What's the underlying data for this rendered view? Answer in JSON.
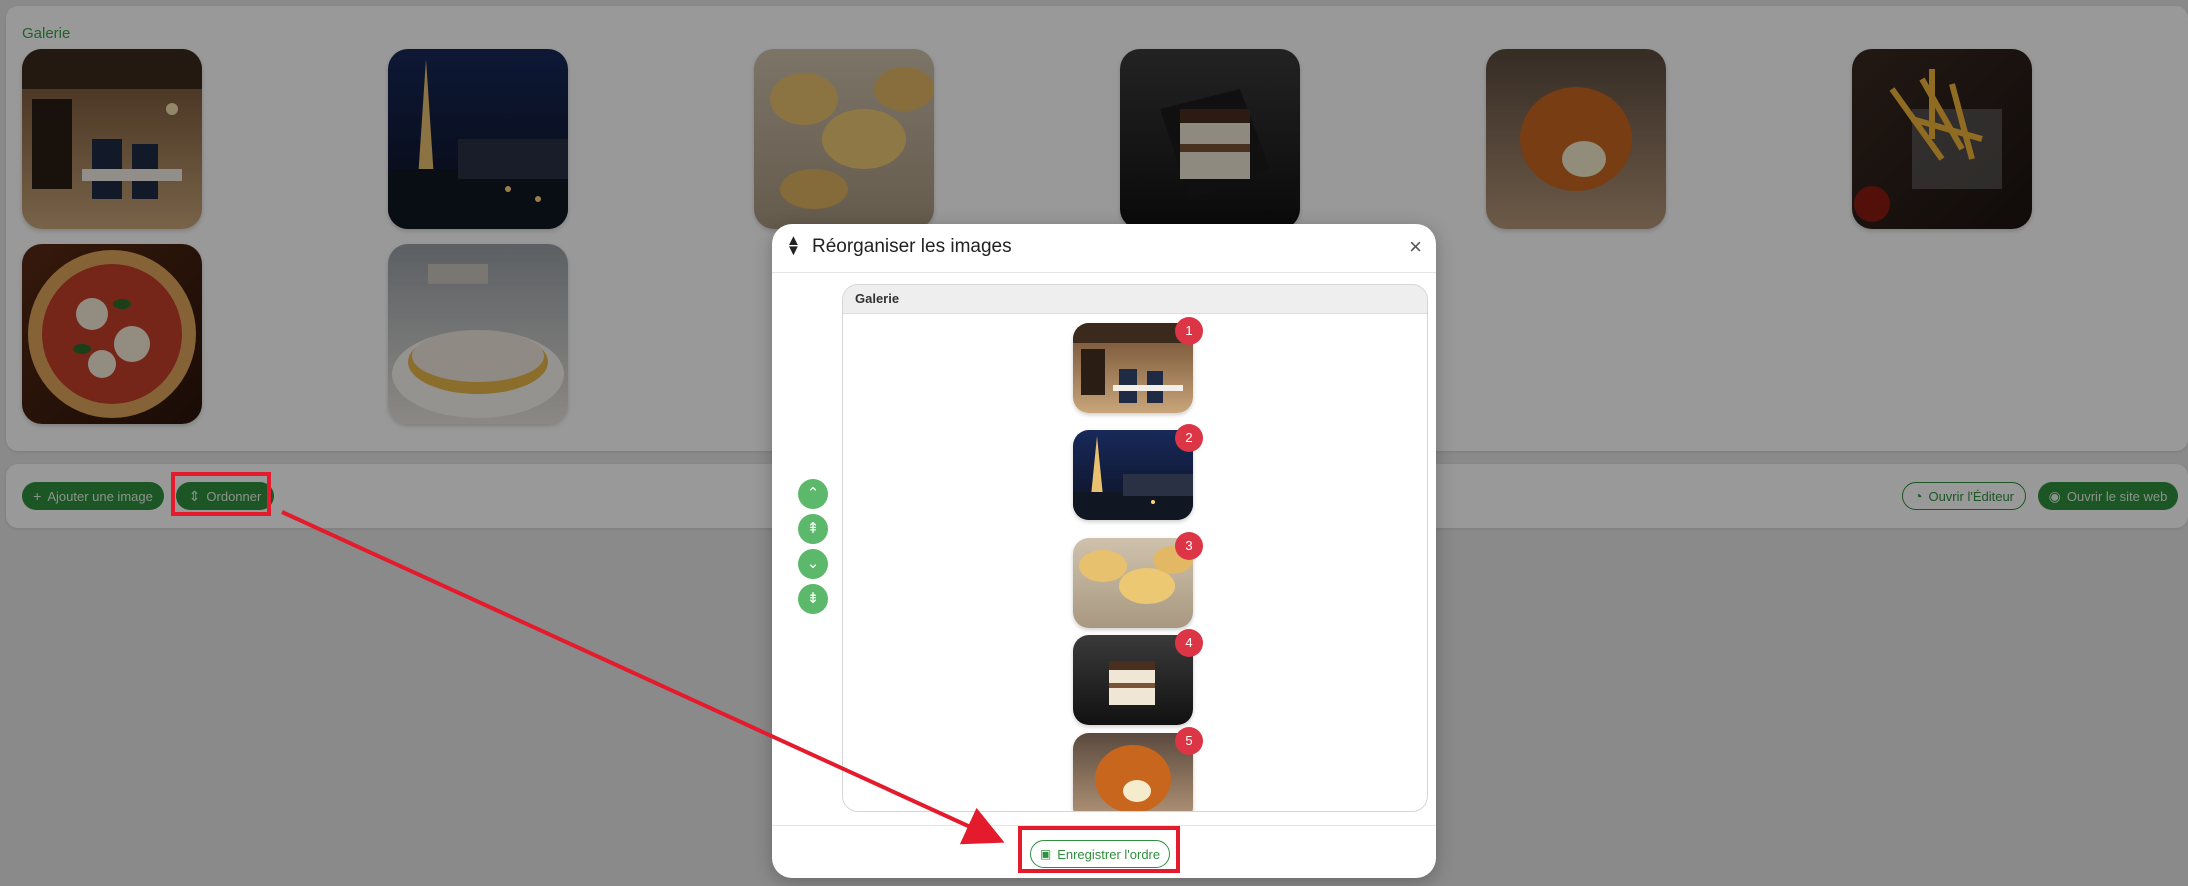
{
  "gallery": {
    "title": "Galerie",
    "images": [
      {
        "alt": "restaurant-interior"
      },
      {
        "alt": "eiffel-tower-terrace"
      },
      {
        "alt": "fresh-pasta"
      },
      {
        "alt": "tiramisu"
      },
      {
        "alt": "arancini"
      },
      {
        "alt": "french-fries"
      },
      {
        "alt": "pizza"
      },
      {
        "alt": "tart"
      }
    ]
  },
  "toolbar": {
    "add_image_label": "Ajouter une image",
    "order_label": "Ordonner",
    "open_editor_label": "Ouvrir l'Éditeur",
    "open_site_label": "Ouvrir le site web"
  },
  "modal": {
    "title": "Réorganiser les images",
    "section_title": "Galerie",
    "items": [
      {
        "number": "1"
      },
      {
        "number": "2"
      },
      {
        "number": "3"
      },
      {
        "number": "4"
      },
      {
        "number": "5"
      }
    ],
    "save_label": "Enregistrer l'ordre"
  },
  "colors": {
    "accent": "#2f8f3f",
    "badge": "#dc3545",
    "annotation": "#e31b2c"
  }
}
